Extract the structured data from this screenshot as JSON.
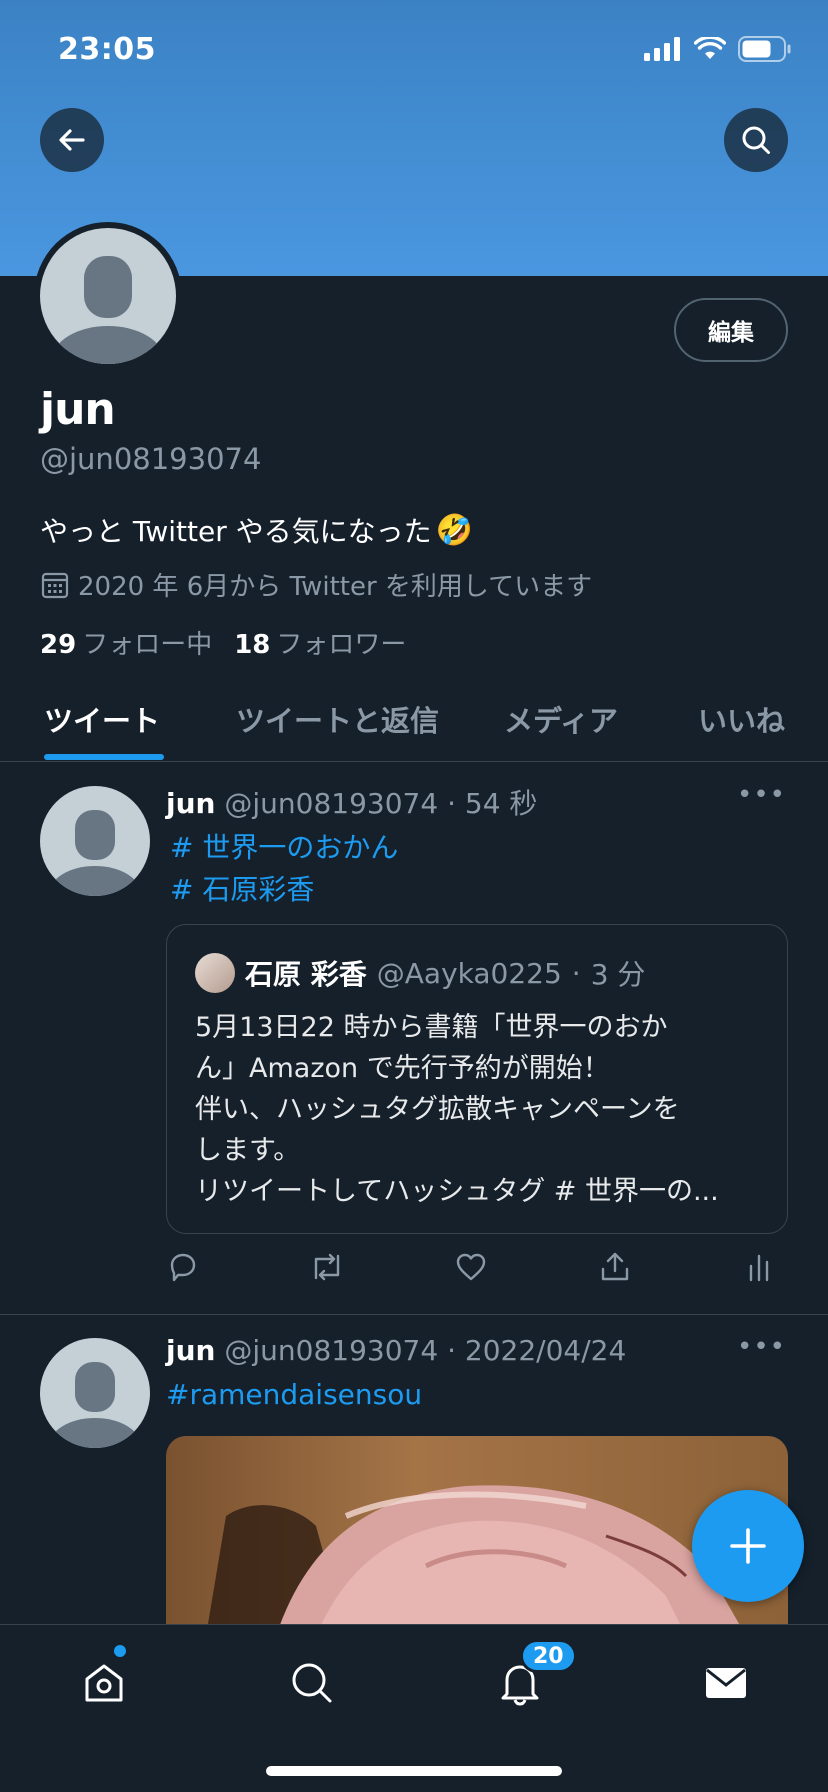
{
  "status_bar": {
    "time": "23:05"
  },
  "profile": {
    "edit_label": "編集",
    "name": "jun",
    "handle": "@jun08193074",
    "bio": "やっと Twitter やる気になった",
    "bio_emoji": "🤣",
    "joined": "2020 年 6月から Twitter を利用しています",
    "following_count": "29",
    "following_label": "フォロー中",
    "followers_count": "18",
    "followers_label": "フォロワー"
  },
  "tabs": [
    {
      "label": "ツイート",
      "active": true
    },
    {
      "label": "ツイートと返信",
      "active": false
    },
    {
      "label": "メディア",
      "active": false
    },
    {
      "label": "いいね",
      "active": false
    }
  ],
  "tweets": [
    {
      "name": "jun",
      "handle": "@jun08193074",
      "time": "54 秒",
      "hashtags": [
        "# 世界一のおかん",
        "# 石原彩香"
      ],
      "quote": {
        "name": "石原 彩香",
        "handle": "@Aayka0225",
        "time": "3 分",
        "lines": [
          "5月13日22 時から書籍「世界一のおか",
          "ん」Amazon で先行予約が開始！",
          "伴い、ハッシュタグ拡散キャンペーンを",
          "します。",
          "リツイートしてハッシュタグ # 世界一の..."
        ]
      }
    },
    {
      "name": "jun",
      "handle": "@jun08193074",
      "time": "2022/04/24",
      "hashtags": [
        "#ramendaisensou"
      ]
    }
  ],
  "bottom_nav": {
    "notifications_badge": "20"
  },
  "colors": {
    "background": "#15202b",
    "accent": "#1d9bf0",
    "muted": "#8b98a5",
    "border": "#38444d"
  }
}
